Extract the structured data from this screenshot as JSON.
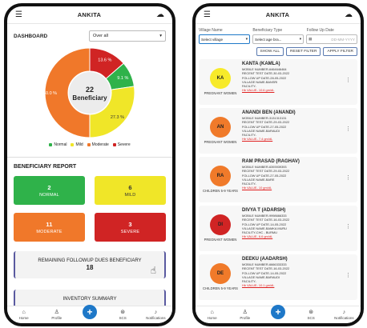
{
  "colors": {
    "normal": "#2fb24a",
    "mild": "#f0e628",
    "moderate": "#f0782a",
    "severe": "#d02424",
    "accent": "#1e78c8"
  },
  "left": {
    "app_title": "ANKITA",
    "menu_icon": "hamburger-icon",
    "cloud_icon": "cloud-icon",
    "dashboard_label": "DASHBOARD",
    "filter_select": {
      "value": "Over all"
    },
    "donut": {
      "center_number": "22",
      "center_label": "Beneficiary"
    },
    "chart_data": {
      "type": "pie",
      "categories": [
        "Normal",
        "Mild",
        "Moderate",
        "Severe"
      ],
      "values": [
        9.1,
        27.3,
        50.0,
        13.6
      ],
      "labels": [
        "9.1 %",
        "27.3 %",
        "50.0 %",
        "13.6 %"
      ]
    },
    "legend": [
      {
        "label": "Normal",
        "color": "#2fb24a"
      },
      {
        "label": "Mild",
        "color": "#f0e628"
      },
      {
        "label": "Moderate",
        "color": "#f0782a"
      },
      {
        "label": "Severe",
        "color": "#d02424"
      }
    ],
    "report_title": "BENEFICIARY REPORT",
    "cards": [
      {
        "count": "2",
        "label": "NORMAL",
        "color": "#2fb24a"
      },
      {
        "count": "6",
        "label": "MILD",
        "color": "#f0e628"
      },
      {
        "count": "11",
        "label": "MODERATE",
        "color": "#f0782a"
      },
      {
        "count": "3",
        "label": "SEVERE",
        "color": "#d02424"
      }
    ],
    "followup": {
      "label": "REMAINING FOLLOWUP DUES BENEFICIARY",
      "count": "18"
    },
    "inventory_label": "INVENTORY SUMMARY"
  },
  "nav": {
    "home": "Home",
    "profile": "Profile",
    "scs": "SCS",
    "notifications": "Notifications"
  },
  "right": {
    "app_title": "ANKITA",
    "filter_labels": [
      "Village Name",
      "Beneficiary Type",
      "Follow Up Date"
    ],
    "village_select": "Select village",
    "type_select": "Select age bra...",
    "date_placeholder": "DD-MM-YYYY",
    "btn_show_all": "SHOW ALL",
    "btn_reset": "RESET FILTER",
    "btn_apply": "APPLY FILTER",
    "beneficiaries": [
      {
        "initials": "KA",
        "avatar_color": "#f7ea2a",
        "category": "PREGNANT WOMEN",
        "name": "KANTA (KAMLA)",
        "mobile": "MOBILE NUMBER-6464646464",
        "recent": "RECENT TEST DATE-30-03-2022",
        "followup": "FOLLOW UP DATE-28-05-2022",
        "village": "VILLAGE NAME-BANSRI",
        "facility": "FACILITY-",
        "hb": "Hb VALUE- 10.6 gm/dL"
      },
      {
        "initials": "AN",
        "avatar_color": "#f07a2a",
        "category": "PREGNANT WOMEN",
        "name": "ANANDI BEN (ANANDI)",
        "mobile": "MOBILE NUMBER-3131313131",
        "recent": "RECENT TEST DATE-29-03-2022",
        "followup": "FOLLOW UP DATE-27-05-2022",
        "village": "VILLAGE NAME-BARAUDI",
        "facility": "FACILITY-",
        "hb": "Hb VALUE- 7.4 gm/dL"
      },
      {
        "initials": "RA",
        "avatar_color": "#f07a2a",
        "category": "CHILDREN 5-9 YEARS",
        "name": "RAM PRASAD (RAGHAV)",
        "mobile": "MOBILE NUMBER-6393939393",
        "recent": "RECENT TEST DATE-29-03-2022",
        "followup": "FOLLOW UP DATE-27-05-2022",
        "village": "VILLAGE NAME-BARE",
        "facility": "FACILITY-",
        "hb": "Hb VALUE- 10 gm/dL"
      },
      {
        "initials": "DI",
        "avatar_color": "#d02424",
        "category": "PREGNANT WOMEN",
        "name": "DIVYA T (ADARSH)",
        "mobile": "MOBILE NUMBER-9998666333",
        "recent": "RECENT TEST DATE-16-03-2022",
        "followup": "FOLLOW UP DATE-14-05-2022",
        "village": "VILLAGE NAME-BAMKA MURU",
        "facility": "FACILITY-CHC - BURMU",
        "hb": "Hb VALUE- 6.6 gm/dL"
      },
      {
        "initials": "DE",
        "avatar_color": "#f07a2a",
        "category": "CHILDREN 5-9 YEARS",
        "name": "DEEKU (AADARSH)",
        "mobile": "MOBILE NUMBER-6666333333",
        "recent": "RECENT TEST DATE-16-03-2022",
        "followup": "FOLLOW UP DATE-14-05-2022",
        "village": "VILLAGE NAME-BARAUDI",
        "facility": "FACILITY-",
        "hb": "Hb VALUE- 10.1 gm/dL"
      }
    ]
  }
}
